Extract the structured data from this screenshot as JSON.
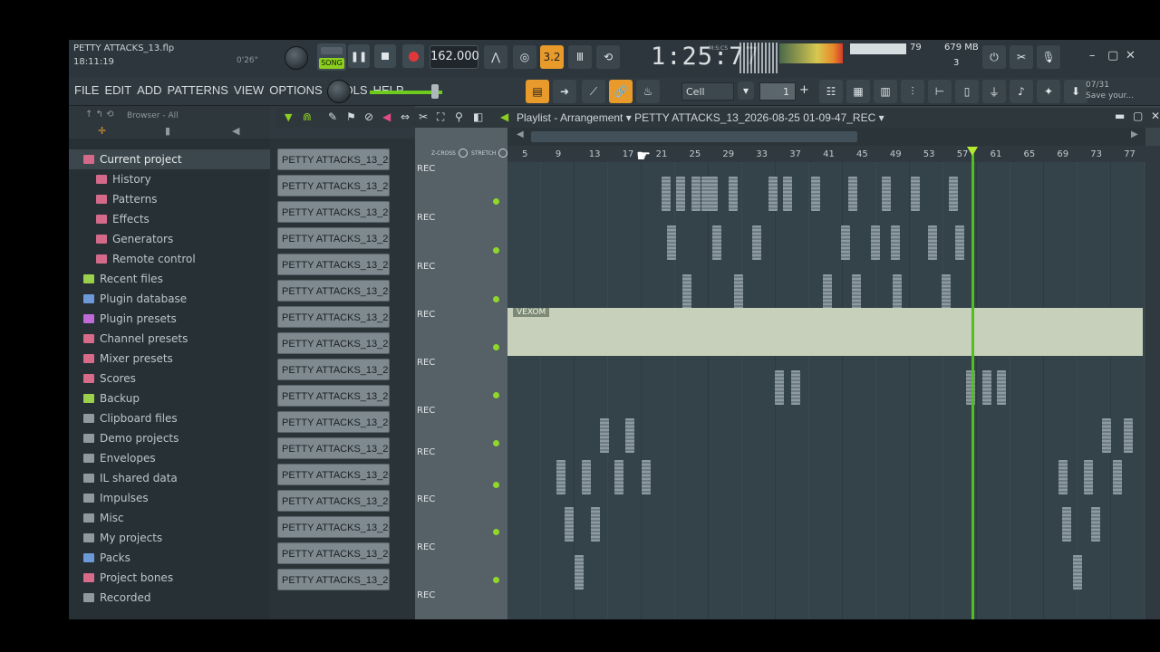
{
  "project": {
    "name": "PETTY ATTACKS_13.flp",
    "clock": "18:11:19",
    "hint_time": "0'26\""
  },
  "transport": {
    "song_label": "SONG",
    "bpm": "162.000",
    "pattern_num": "3.2",
    "time": "1:25:77",
    "time_unit": "M:S:CS"
  },
  "stats": {
    "cpu": "79",
    "memory": "679 MB",
    "polyphony": "3",
    "save_hint_line1": "07/31",
    "save_hint_line2": "Save your..."
  },
  "menu": [
    "FILE",
    "EDIT",
    "ADD",
    "PATTERNS",
    "VIEW",
    "OPTIONS",
    "TOOLS",
    "HELP"
  ],
  "toolbar": {
    "snap_label": "Cell",
    "step_value": "1"
  },
  "browser": {
    "title": "Browser - All",
    "items": [
      {
        "label": "Current project",
        "color": "#d36a8a",
        "indent": 0,
        "selected": true
      },
      {
        "label": "History",
        "color": "#d36a8a",
        "indent": 1
      },
      {
        "label": "Patterns",
        "color": "#d36a8a",
        "indent": 1
      },
      {
        "label": "Effects",
        "color": "#d36a8a",
        "indent": 1
      },
      {
        "label": "Generators",
        "color": "#d36a8a",
        "indent": 1
      },
      {
        "label": "Remote control",
        "color": "#d36a8a",
        "indent": 1
      },
      {
        "label": "Recent files",
        "color": "#9ad04c",
        "indent": 0
      },
      {
        "label": "Plugin database",
        "color": "#6c9ad8",
        "indent": 0
      },
      {
        "label": "Plugin presets",
        "color": "#c06ad8",
        "indent": 0
      },
      {
        "label": "Channel presets",
        "color": "#d86a8a",
        "indent": 0
      },
      {
        "label": "Mixer presets",
        "color": "#d86a8a",
        "indent": 0
      },
      {
        "label": "Scores",
        "color": "#d86a8a",
        "indent": 0
      },
      {
        "label": "Backup",
        "color": "#9ad04c",
        "indent": 0
      },
      {
        "label": "Clipboard files",
        "color": "#8f9aa0",
        "indent": 0
      },
      {
        "label": "Demo projects",
        "color": "#8f9aa0",
        "indent": 0
      },
      {
        "label": "Envelopes",
        "color": "#8f9aa0",
        "indent": 0
      },
      {
        "label": "IL shared data",
        "color": "#8f9aa0",
        "indent": 0
      },
      {
        "label": "Impulses",
        "color": "#8f9aa0",
        "indent": 0
      },
      {
        "label": "Misc",
        "color": "#8f9aa0",
        "indent": 0
      },
      {
        "label": "My projects",
        "color": "#8f9aa0",
        "indent": 0
      },
      {
        "label": "Packs",
        "color": "#6c9ad8",
        "indent": 0
      },
      {
        "label": "Project bones",
        "color": "#d86a8a",
        "indent": 0
      },
      {
        "label": "Recorded",
        "color": "#8f9aa0",
        "indent": 0
      }
    ]
  },
  "playlist": {
    "title": "Playlist - Arrangement",
    "arrangement": "PETTY ATTACKS_13_2026-08-25 01-09-47_REC",
    "zcross": "Z-CROSS",
    "stretch": "STRETCH",
    "ruler_ticks": [
      "5",
      "9",
      "13",
      "17",
      "21",
      "25",
      "29",
      "33",
      "37",
      "41",
      "45",
      "49",
      "53",
      "57",
      "61",
      "65",
      "69",
      "73",
      "77"
    ],
    "track_label": "REC",
    "clip_label": "VEXOM",
    "channels": [
      "PETTY ATTACKS_13_2026...",
      "PETTY ATTACKS_13_2026...",
      "PETTY ATTACKS_13_2026...",
      "PETTY ATTACKS_13_2026...",
      "PETTY ATTACKS_13_2026...",
      "PETTY ATTACKS_13_2026...",
      "PETTY ATTACKS_13_2026...",
      "PETTY ATTACKS_13_2026...",
      "PETTY ATTACKS_13_2026...",
      "PETTY ATTACKS_13_2026...",
      "PETTY ATTACKS_13_2026...",
      "PETTY ATTACKS_13_2026...",
      "PETTY ATTACKS_13_2026...",
      "PETTY ATTACKS_13_2026...",
      "PETTY ATTACKS_13_2026...",
      "PETTY ATTACKS_13_2026...",
      "PETTY ATTACKS_13_2026..."
    ]
  }
}
